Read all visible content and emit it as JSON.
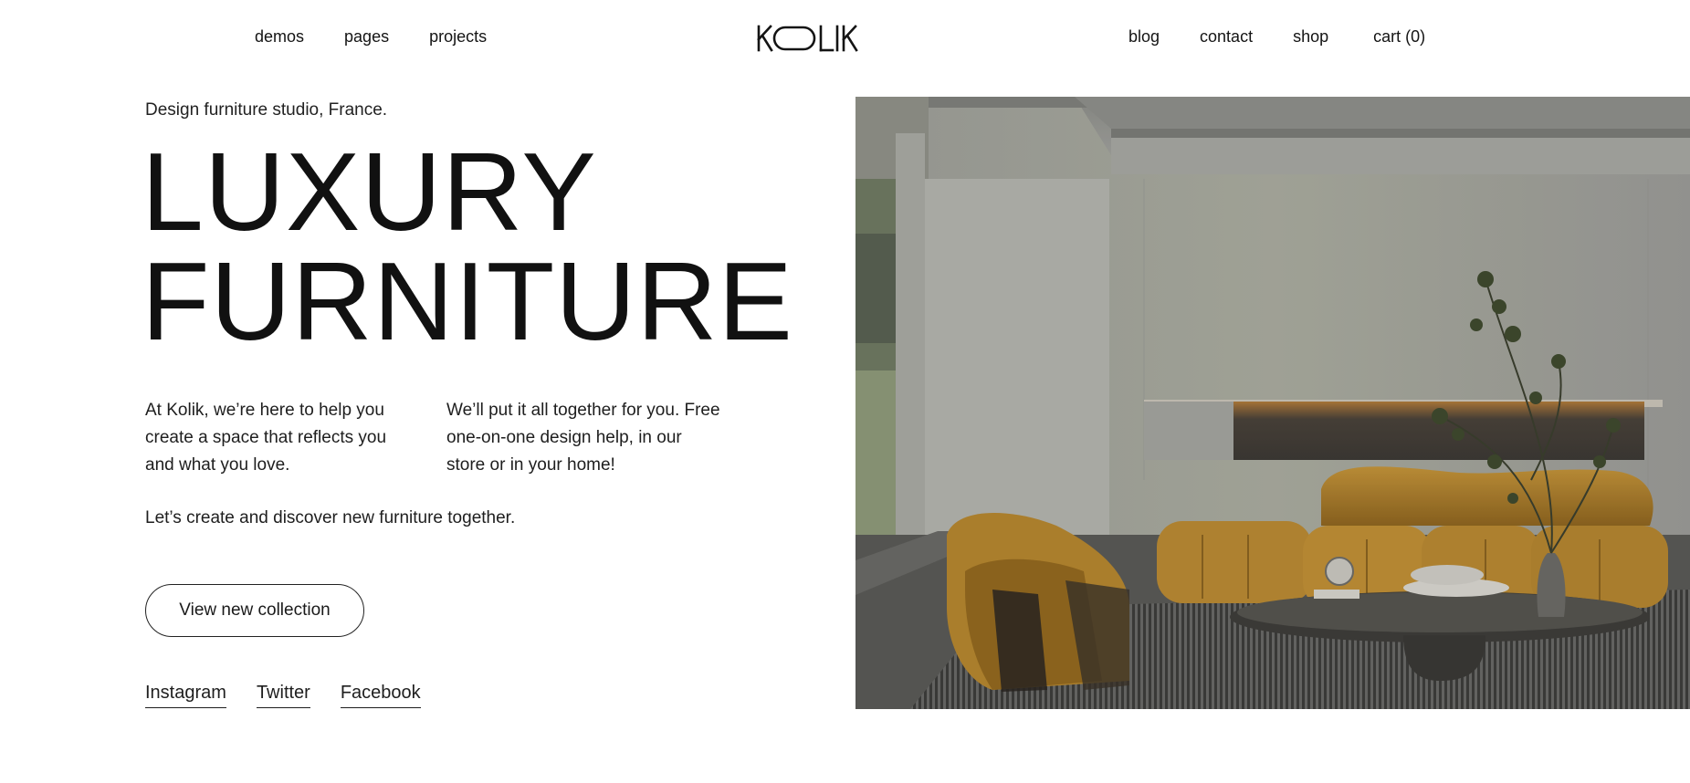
{
  "header": {
    "nav_left": [
      "demos",
      "pages",
      "projects"
    ],
    "logo_text": "KOLIK",
    "nav_right": [
      "blog",
      "contact",
      "shop"
    ],
    "cart_label": "cart (0)"
  },
  "hero": {
    "subtitle": "Design furniture studio, France.",
    "title_line1": "LUXURY",
    "title_line2": "FURNITURE",
    "paragraph1": "At Kolik, we’re here to help you create a space that reflects you and what you love.",
    "paragraph2": "We’ll put it all together for you. Free one-on-one design help, in our store or in your home!",
    "tagline": "Let’s create and discover new furniture together.",
    "cta_label": "View new collection"
  },
  "socials": [
    "Instagram",
    "Twitter",
    "Facebook"
  ],
  "colors": {
    "text": "#141414",
    "background": "#ffffff",
    "sofa": "#b8872f"
  }
}
